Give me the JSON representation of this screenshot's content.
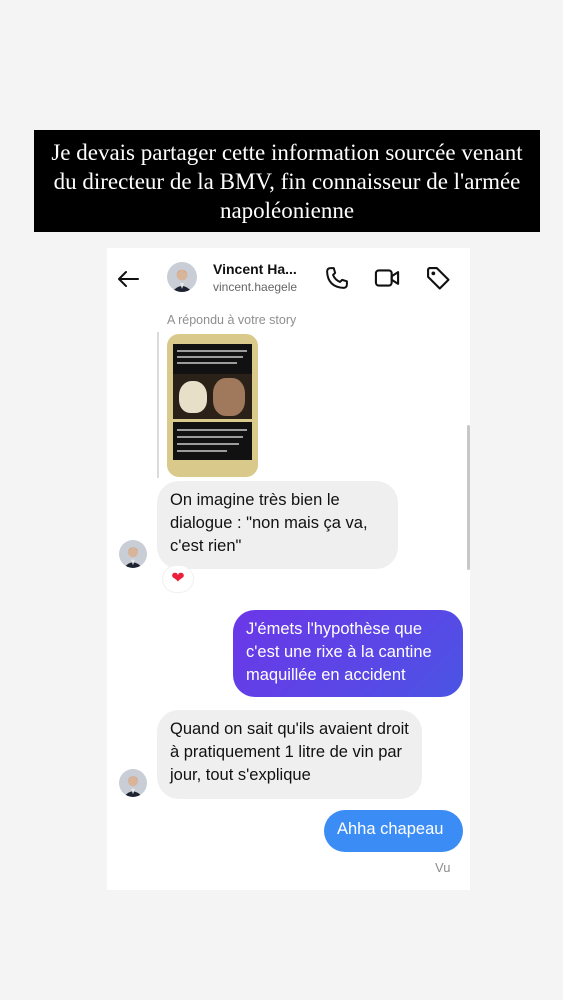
{
  "banner": {
    "text": "Je devais partager cette information sourcée venant du directeur de la BMV, fin connaisseur de l'armée napoléonienne"
  },
  "header": {
    "name": "Vincent Ha...",
    "username": "vincent.haegele",
    "icons": [
      "back-arrow-icon",
      "phone-icon",
      "video-icon",
      "tag-icon"
    ]
  },
  "conversation": {
    "replied_label": "A répondu à votre story",
    "messages": [
      {
        "from": "them",
        "text": "On imagine très bien le dialogue : \"non mais ça va, c'est rien\"",
        "reaction": "❤"
      },
      {
        "from": "me",
        "text": "J'émets l'hypothèse que c'est une rixe à la cantine maquillée en accident"
      },
      {
        "from": "them",
        "text": "Quand on sait qu'ils avaient droit à pratiquement 1 litre de vin par jour, tout s'explique"
      },
      {
        "from": "me",
        "text": "Ahha chapeau"
      }
    ],
    "seen_label": "Vu"
  },
  "colors": {
    "outgoing_gradient_start": "#6b37e8",
    "outgoing_gradient_end": "#4a55e4",
    "outgoing_blue": "#3b8df5",
    "incoming_bg": "#efefef",
    "banner_bg": "#000000"
  }
}
